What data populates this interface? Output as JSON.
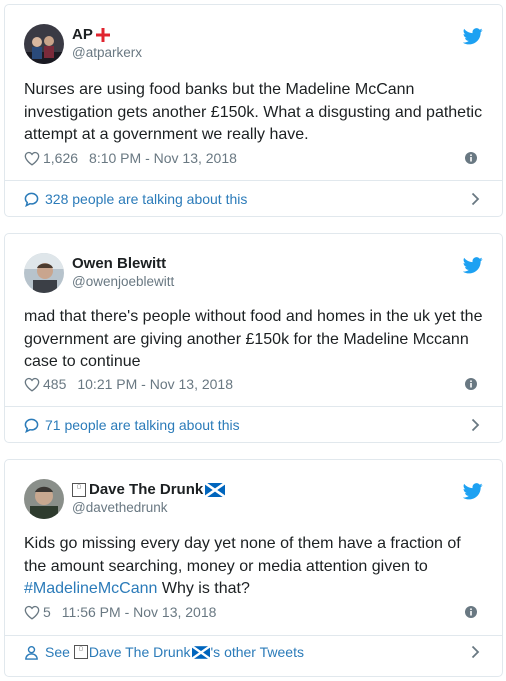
{
  "tweets": [
    {
      "display_name": "AP",
      "handle": "@atparkerx",
      "text": "Nurses are using food banks but the Madeline McCann investigation gets another £150k. What a disgusting and pathetic attempt at a government we really have.",
      "likes": "1,626",
      "time": "8:10 PM - Nov 13, 2018",
      "footer": "328 people are talking about this"
    },
    {
      "display_name": "Owen Blewitt",
      "handle": "@owenjoeblewitt",
      "text": "mad that there's people without food and homes in the uk yet the government are giving another £150k for the Madeline Mccann case to continue",
      "likes": "485",
      "time": "10:21 PM - Nov 13, 2018",
      "footer": "71 people are talking about this"
    },
    {
      "display_name": "Dave The Drunk",
      "handle": "@davethedrunk",
      "text_before": "Kids go missing every day yet none of them have a fraction of the amount searching, money or media attention given to",
      "hashtag": "#MadelineMcCann",
      "text_after": " Why is that?",
      "likes": "5",
      "time": "11:56 PM - Nov 13, 2018",
      "footer_prefix": "See ",
      "footer_name": "Dave The Drunk",
      "footer_suffix": "'s other Tweets"
    }
  ],
  "colors": {
    "twitter_blue": "#1da1f2",
    "link": "#2b7bb9",
    "meta": "#697882",
    "border": "#e1e8ed"
  }
}
